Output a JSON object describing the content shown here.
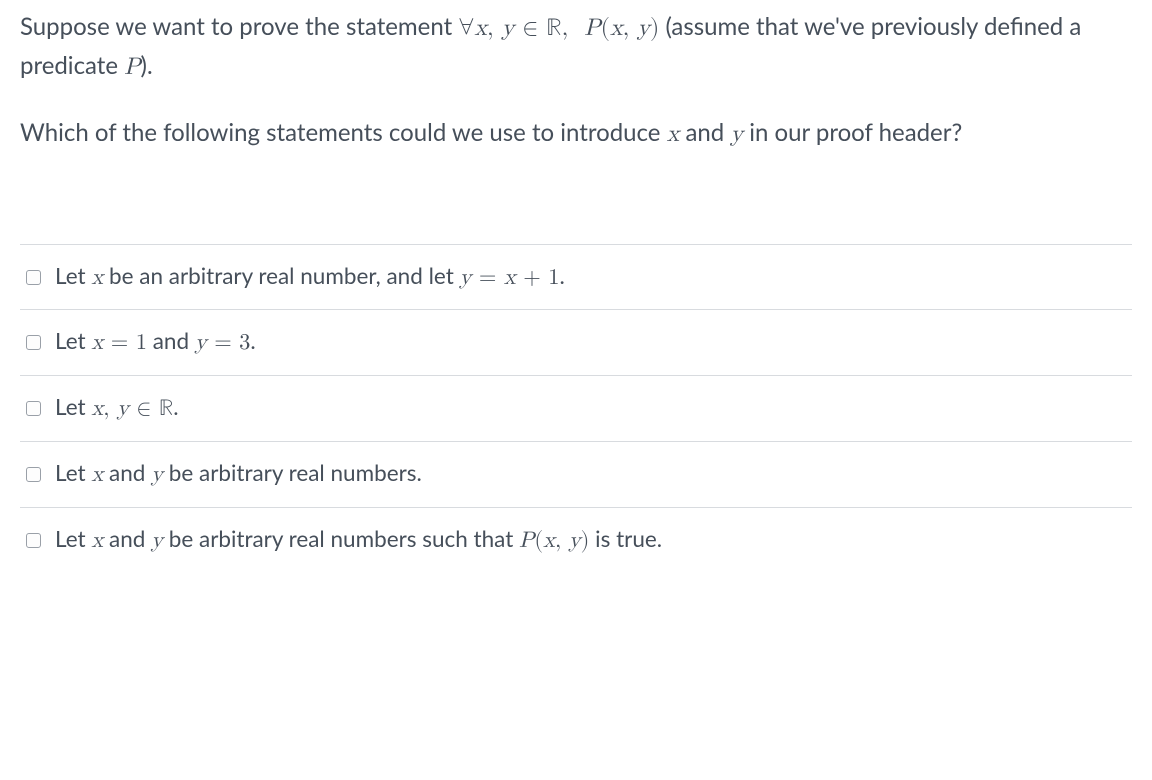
{
  "question": {
    "paragraph1_pre": "Suppose we want to prove the statement ",
    "paragraph1_math": "∀x, y ∈ ℝ,  P(x, y)",
    "paragraph1_post": " (assume that we've previously defined a predicate ",
    "paragraph1_math2": "P",
    "paragraph1_end": ").",
    "paragraph2_pre": "Which of the following statements could we use to introduce ",
    "paragraph2_x": "x",
    "paragraph2_mid": " and ",
    "paragraph2_y": "y",
    "paragraph2_post": " in our proof header?"
  },
  "options": [
    {
      "prefix": "Let ",
      "m1": "x",
      "t1": " be an arbitrary real number, and let ",
      "m2": "y = x + 1",
      "t2": "."
    },
    {
      "prefix": "Let ",
      "m1": "x = 1",
      "t1": " and ",
      "m2": "y = 3",
      "t2": "."
    },
    {
      "prefix": "Let ",
      "m1": "x, y ∈ ℝ",
      "t1": ".",
      "m2": "",
      "t2": ""
    },
    {
      "prefix": "Let ",
      "m1": "x",
      "t1": " and ",
      "m2": "y",
      "t2": " be arbitrary real numbers."
    },
    {
      "prefix": "Let ",
      "m1": "x",
      "t1": " and ",
      "m2": "y",
      "t2": " be arbitrary real numbers such that ",
      "m3": "P(x, y)",
      "t3": " is true."
    }
  ]
}
